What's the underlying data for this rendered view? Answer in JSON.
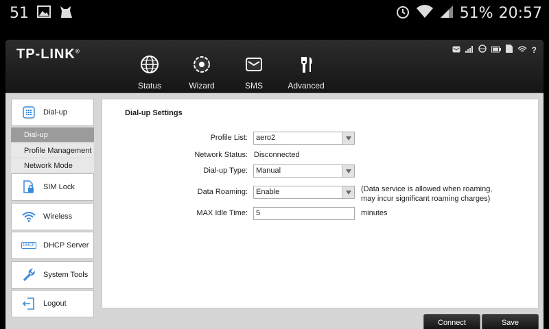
{
  "statusbar": {
    "notification_count": "51",
    "battery_percent": "51%",
    "clock": "20:57",
    "left_icons": [
      "image-icon",
      "cat-app-icon"
    ],
    "right_icons": [
      "alarm-icon",
      "wifi-icon",
      "cell-signal-icon"
    ]
  },
  "header": {
    "logo_text": "TP-LINK",
    "logo_mark": "®",
    "nav": [
      {
        "label": "Status",
        "icon": "globe-icon"
      },
      {
        "label": "Wizard",
        "icon": "gear-icon"
      },
      {
        "label": "SMS",
        "icon": "envelope-icon"
      },
      {
        "label": "Advanced",
        "icon": "tools-icon"
      }
    ],
    "status_icons": [
      "sms-icon",
      "signal-icon",
      "globe-icon",
      "battery-icon",
      "sim-icon",
      "wifi-icon",
      "help-icon"
    ]
  },
  "sidebar": {
    "dialup": "Dial-up",
    "sub_items": [
      "Dial-up",
      "Profile Management",
      "Network Mode"
    ],
    "simlock": "SIM Lock",
    "wireless": "Wireless",
    "dhcp": "DHCP Server",
    "dhcp_badge": "DHCP",
    "systemtools": "System Tools",
    "logout": "Logout"
  },
  "main": {
    "title": "Dial-up Settings",
    "profile_list_label": "Profile List:",
    "profile_list_value": "aero2",
    "network_status_label": "Network Status:",
    "network_status_value": "Disconnected",
    "dialup_type_label": "Dial-up Type:",
    "dialup_type_value": "Manual",
    "data_roaming_label": "Data Roaming:",
    "data_roaming_value": "Enable",
    "data_roaming_note": "(Data service is allowed when roaming, may incur significant roaming charges)",
    "max_idle_label": "MAX Idle Time:",
    "max_idle_value": "5",
    "max_idle_unit": "minutes"
  },
  "footer": {
    "connect": "Connect",
    "save": "Save"
  },
  "colors": {
    "header_bg": "#1e1e1e",
    "active_sub": "#9b9b9b",
    "accent_icon": "#5aa0e0"
  }
}
